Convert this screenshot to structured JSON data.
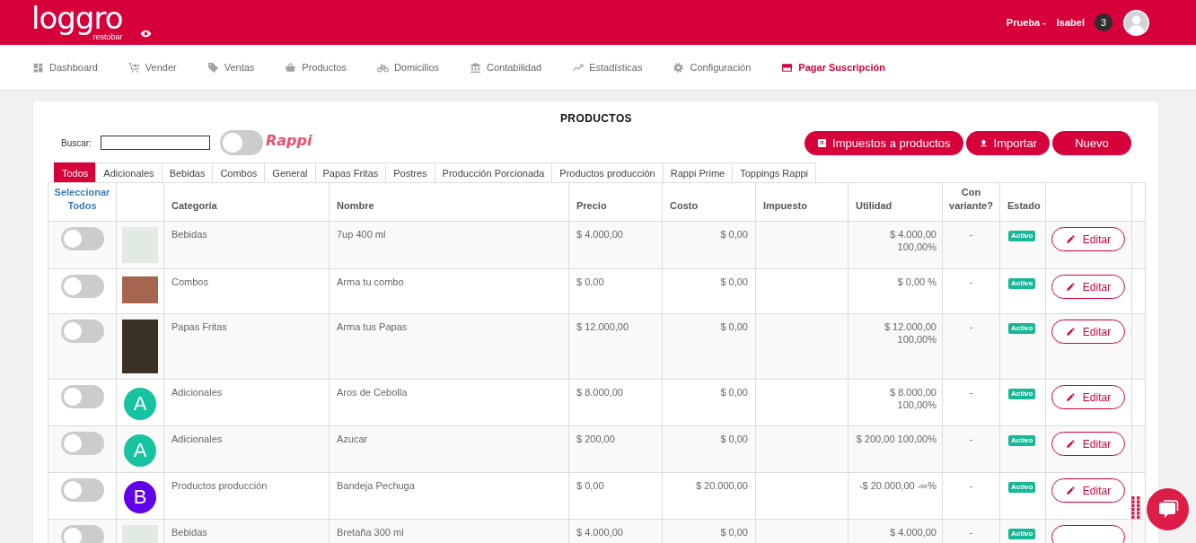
{
  "header": {
    "logo": "loggro",
    "logo_tagline": "restobar",
    "user_label": "Prueba -",
    "user_name": "Isabel",
    "notifications": "3"
  },
  "nav": [
    {
      "label": "Dashboard",
      "highlighted": false
    },
    {
      "label": "Vender",
      "highlighted": false
    },
    {
      "label": "Ventas",
      "highlighted": false
    },
    {
      "label": "Productos",
      "highlighted": false
    },
    {
      "label": "Domicilios",
      "highlighted": false
    },
    {
      "label": "Contabilidad",
      "highlighted": false
    },
    {
      "label": "Estadísticas",
      "highlighted": false
    },
    {
      "label": "Configuración",
      "highlighted": false
    },
    {
      "label": "Pagar Suscripción",
      "highlighted": true
    }
  ],
  "title": "PRODUCTOS",
  "search": {
    "label": "Buscar:"
  },
  "rappi": {
    "label": "Rappi",
    "on": false
  },
  "buttons": [
    {
      "label": "Impuestos a productos",
      "kind": "taxes"
    },
    {
      "label": "Importar",
      "kind": "import"
    },
    {
      "label": "Nuevo",
      "kind": "plain"
    }
  ],
  "tabs": [
    {
      "label": "Todos",
      "selected": true
    },
    {
      "label": "Adicionales",
      "selected": false
    },
    {
      "label": "Bebidas",
      "selected": false
    },
    {
      "label": "Combos",
      "selected": false
    },
    {
      "label": "General",
      "selected": false
    },
    {
      "label": "Papas Fritas",
      "selected": false
    },
    {
      "label": "Postres",
      "selected": false
    },
    {
      "label": "Producción Porcionada",
      "selected": false
    },
    {
      "label": "Productos producción",
      "selected": false
    },
    {
      "label": "Rappi Prime",
      "selected": false
    },
    {
      "label": "Toppings Rappi",
      "selected": false
    }
  ],
  "table": {
    "select_all": "Seleccionar Todos",
    "columns": [
      "Categoría",
      "Nombre",
      "Precio",
      "Costo",
      "Impuesto",
      "Utilidad",
      "Con variante?",
      "Estado"
    ],
    "rows": [
      {
        "selected": false,
        "image": {
          "kind": "photo"
        },
        "category": "Bebidas",
        "name": "7up 400 ml",
        "price": "$ 4.000,00",
        "cost": "$ 0,00",
        "utility": "$ 4.000,00 100,00%",
        "variant": "-",
        "status": "Activo",
        "action": "Editar"
      },
      {
        "selected": false,
        "image": {
          "kind": "wide-photo"
        },
        "category": "Combos",
        "name": "Arma tu combo",
        "price": "$ 0,00",
        "cost": "$ 0,00",
        "utility": "$ 0,00 %",
        "variant": "-",
        "status": "Activo",
        "action": "Editar"
      },
      {
        "selected": false,
        "image": {
          "kind": "tall-photo"
        },
        "category": "Papas Fritas",
        "name": "Arma tus Papas",
        "price": "$ 12.000,00",
        "cost": "$ 0,00",
        "utility": "$ 12.000,00 100,00%",
        "variant": "-",
        "status": "Activo",
        "action": "Editar"
      },
      {
        "selected": false,
        "image": {
          "kind": "letter",
          "letter": "A",
          "color": "#17c3a1"
        },
        "category": "Adicionales",
        "name": "Aros de Cebolla",
        "price": "$ 8.000,00",
        "cost": "$ 0,00",
        "utility": "$ 8.000,00 100,00%",
        "variant": "-",
        "status": "Activo",
        "action": "Editar"
      },
      {
        "selected": false,
        "image": {
          "kind": "letter",
          "letter": "A",
          "color": "#17c3a1"
        },
        "category": "Adicionales",
        "name": "Azucar",
        "price": "$ 200,00",
        "cost": "$ 0,00",
        "utility": "$ 200,00 100,00%",
        "variant": "-",
        "status": "Activo",
        "action": "Editar"
      },
      {
        "selected": false,
        "image": {
          "kind": "letter",
          "letter": "B",
          "color": "#6200ea"
        },
        "category": "Productos producción",
        "name": "Bandeja Pechuga",
        "price": "$ 0,00",
        "cost": "$ 20.000,00",
        "utility": "-$ 20.000,00 -∞%",
        "variant": "-",
        "status": "Activo",
        "action": "Editar"
      },
      {
        "selected": false,
        "image": {
          "kind": "photo"
        },
        "category": "Bebidas",
        "name": "Bretaña 300 ml",
        "price": "$ 4.000,00",
        "cost": "$ 0,00",
        "utility": "$ 4.000,00",
        "variant": "-",
        "status": "Activo"
      }
    ]
  }
}
